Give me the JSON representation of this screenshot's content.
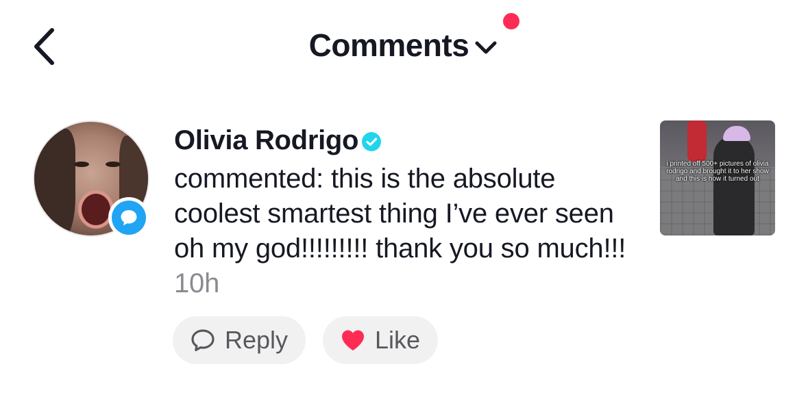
{
  "header": {
    "title": "Comments",
    "back_icon": "chevron-left-icon",
    "dropdown_icon": "chevron-down-icon",
    "notification_dot_color": "#fe2c55"
  },
  "comment": {
    "author": "Olivia Rodrigo",
    "verified": true,
    "verified_color": "#20d5ec",
    "text": "commented: this is the absolute coolest smartest thing I’ve ever seen oh my god!!!!!!!!! thank you so much!!!",
    "time": "10h",
    "badge_icon": "comment-bubble-icon",
    "badge_color": "#20a4f3"
  },
  "thumbnail": {
    "caption": "i printed off 500+ pictures of olivia rodrigo and brought it to her show and this is how it turned out"
  },
  "actions": {
    "reply_label": "Reply",
    "like_label": "Like",
    "like_color": "#fe2c55"
  }
}
